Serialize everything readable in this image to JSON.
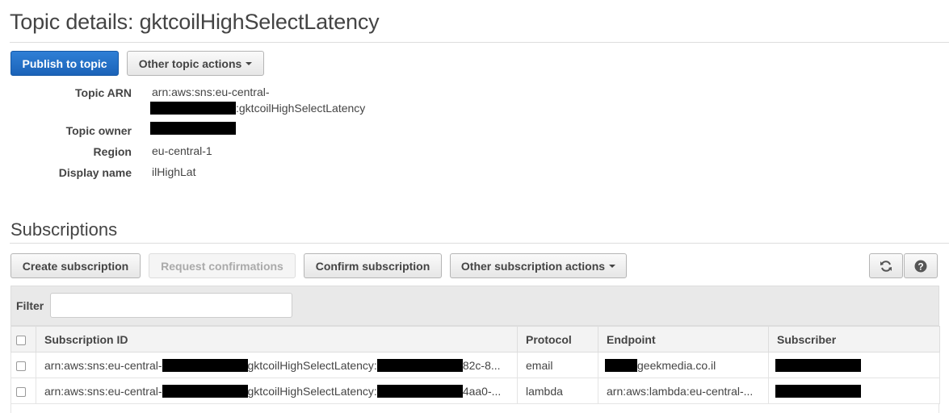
{
  "page": {
    "title": "Topic details: gktcoilHighSelectLatency"
  },
  "actions": {
    "publish_label": "Publish to topic",
    "other_topic_actions_label": "Other topic actions"
  },
  "details": {
    "arn_label": "Topic ARN",
    "arn_line1": "arn:aws:sns:eu-central-",
    "arn_line2_suffix": ":gktcoilHighSelectLatency",
    "owner_label": "Topic owner",
    "region_label": "Region",
    "region_value": "eu-central-1",
    "display_name_label": "Display name",
    "display_name_value": "ilHighLat"
  },
  "subscriptions": {
    "title": "Subscriptions",
    "buttons": {
      "create": "Create subscription",
      "request": "Request confirmations",
      "confirm": "Confirm subscription",
      "other": "Other subscription actions"
    },
    "icons": [
      "refresh-icon",
      "help-icon"
    ],
    "filter_label": "Filter",
    "filter_value": "",
    "columns": [
      "Subscription ID",
      "Protocol",
      "Endpoint",
      "Subscriber"
    ],
    "rows": [
      {
        "id_prefix": "arn:aws:sns:eu-central-",
        "id_middle": "gktcoilHighSelectLatency:",
        "id_suffix": "82c-8...",
        "protocol": "email",
        "endpoint": "geekmedia.co.il"
      },
      {
        "id_prefix": "arn:aws:sns:eu-central-",
        "id_middle": "gktcoilHighSelectLatency:",
        "id_suffix": "4aa0-...",
        "protocol": "lambda",
        "endpoint": "arn:aws:lambda:eu-central-..."
      }
    ]
  },
  "colors": {
    "primary": "#1b63b8",
    "redaction": "#000000",
    "header_bg": "#f3f3f3"
  }
}
